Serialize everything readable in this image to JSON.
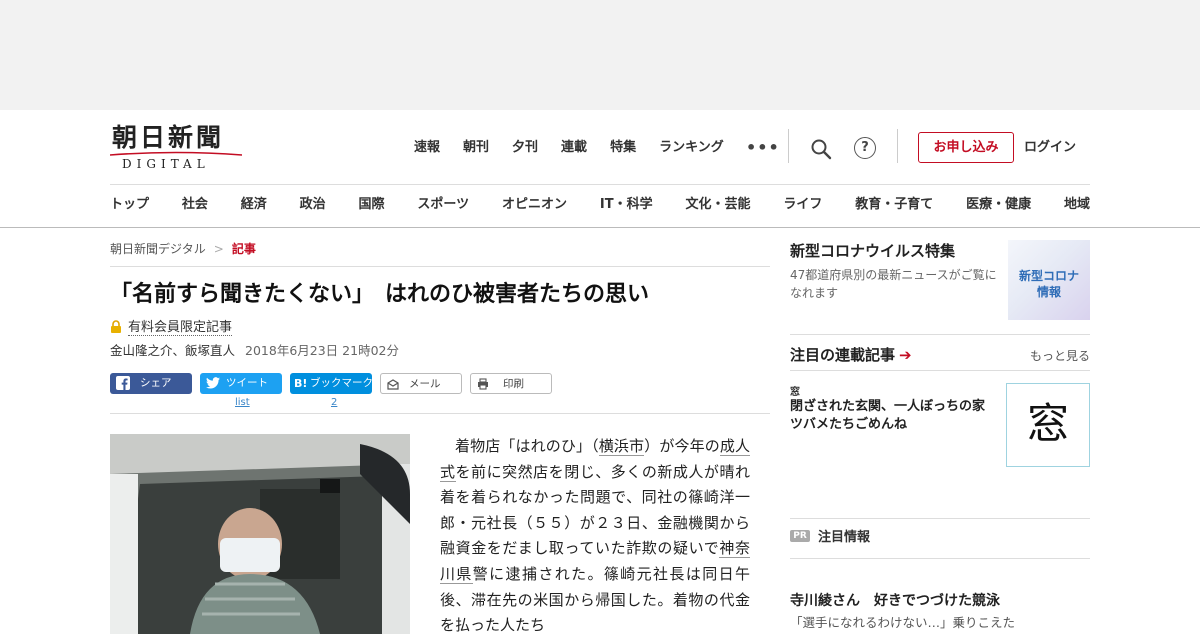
{
  "header": {
    "logo_kanji": "朝日新聞",
    "logo_sub": "DIGITAL",
    "top_nav": [
      "速報",
      "朝刊",
      "夕刊",
      "連載",
      "特集",
      "ランキング"
    ],
    "more_label": "•••",
    "help_label": "?",
    "apply_label": "お申し込み",
    "login_label": "ログイン",
    "category_nav": [
      "トップ",
      "社会",
      "経済",
      "政治",
      "国際",
      "スポーツ",
      "オピニオン",
      "IT・科学",
      "文化・芸能",
      "ライフ",
      "教育・子育て",
      "医療・健康",
      "地域"
    ]
  },
  "breadcrumb": {
    "home": "朝日新聞デジタル",
    "separator": ">",
    "current": "記事"
  },
  "article": {
    "title": "「名前すら聞きたくない」　はれのひ被害者たちの思い",
    "paid_label": "有料会員限定記事",
    "authors": "金山隆之介、飯塚直人",
    "date": "2018年6月23日 21時02分",
    "share": {
      "facebook": "シェア",
      "twitter": "ツイート",
      "twitter_count": "list",
      "hatena": "ブックマーク",
      "hatena_count": "2",
      "mail": "メール",
      "print": "印刷"
    },
    "body_parts": {
      "p1": "着物店「はれのひ」（",
      "link1": "横浜市",
      "p2": "）が今年の",
      "link2": "成人式",
      "p3": "を前に突然店を閉じ、多くの新成人が晴れ着を着られなかった問題で、同社の篠崎洋一郎・元社長（５５）が２３日、金融機関から融資金をだまし取っていた詐欺の疑いで",
      "link3": "神奈川県",
      "p4": "警に逮捕された。篠崎元社長は同日午後、滞在先の米国から帰国した。着物の代金を払った人たち"
    }
  },
  "sidebar": {
    "corona_title": "新型コロナウイルス特集",
    "corona_desc": "47都道府県別の最新ニュースがご覧になれます",
    "corona_thumb": "新型コロナ\n情報",
    "serial_title": "注目の連載記事",
    "serial_more": "もっと見る",
    "serial_tag": "窓",
    "serial_item_title": "閉ざされた玄関、一人ぼっちの家　ツバメたちごめんね",
    "serial_thumb": "窓",
    "pr_badge": "PR",
    "pr_title": "注目情報",
    "pr_item_title": "寺川綾さん　好きでつづけた競泳",
    "pr_item_desc": "「選手になれるわけない…」乗りこえた"
  },
  "colors": {
    "brand_red": "#c30d23",
    "facebook": "#3b5998",
    "twitter": "#1da1f2",
    "hatena": "#008fde"
  }
}
